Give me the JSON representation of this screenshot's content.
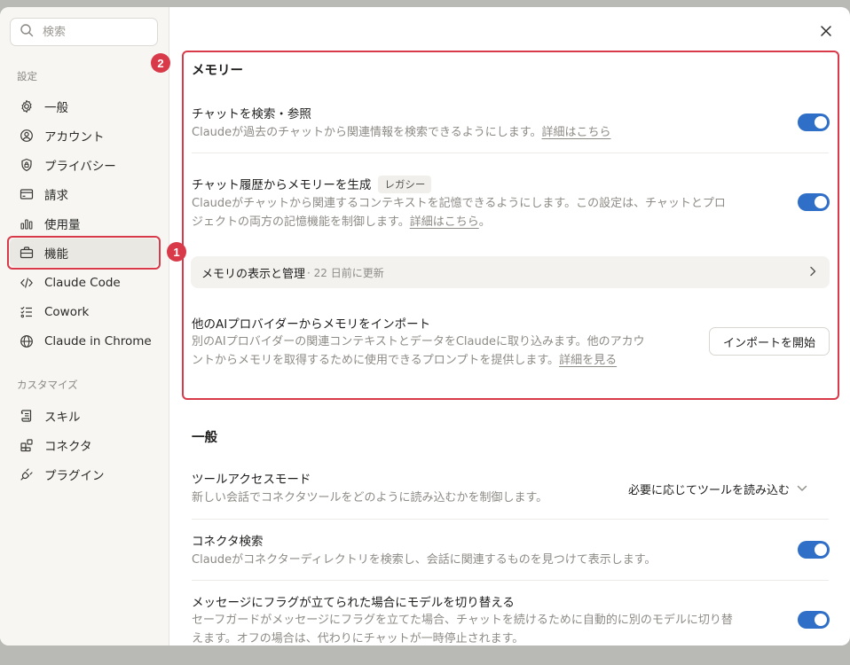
{
  "search": {
    "placeholder": "検索"
  },
  "sidebar": {
    "settings_label": "設定",
    "items": [
      {
        "label": "一般",
        "icon": "gear-icon"
      },
      {
        "label": "アカウント",
        "icon": "user-icon"
      },
      {
        "label": "プライバシー",
        "icon": "shield-lock-icon"
      },
      {
        "label": "請求",
        "icon": "card-icon"
      },
      {
        "label": "使用量",
        "icon": "bar-chart-icon"
      },
      {
        "label": "機能",
        "icon": "briefcase-icon",
        "active": true
      },
      {
        "label": "Claude Code",
        "icon": "code-icon"
      },
      {
        "label": "Cowork",
        "icon": "checklist-icon"
      },
      {
        "label": "Claude in Chrome",
        "icon": "globe-icon"
      }
    ],
    "customize_label": "カスタマイズ",
    "custom_items": [
      {
        "label": "スキル",
        "icon": "scroll-icon"
      },
      {
        "label": "コネクタ",
        "icon": "connector-icon"
      },
      {
        "label": "プラグイン",
        "icon": "plug-icon"
      }
    ]
  },
  "annotations": {
    "badge1": "1",
    "badge2": "2",
    "highlight_color": "#d93a4a"
  },
  "memory": {
    "title": "メモリー",
    "search_chats": {
      "title": "チャットを検索・参照",
      "desc": "Claudeが過去のチャットから関連情報を検索できるようにします。",
      "link": "詳細はこちら",
      "enabled": true
    },
    "generate": {
      "title": "チャット履歴からメモリーを生成",
      "tag": "レガシー",
      "desc_line1": "Claudeがチャットから関連するコンテキストを記憶できるようにします。この設定は、チャットとプロ",
      "desc_line2": "ジェクトの両方の記憶機能を制御します。",
      "link": "詳細はこちら",
      "suffix": "。",
      "enabled": true
    },
    "manage": {
      "label": "メモリの表示と管理",
      "sub": "· 22 日前に更新"
    },
    "import": {
      "title": "他のAIプロバイダーからメモリをインポート",
      "desc_line1": "別のAIプロバイダーの関連コンテキストとデータをClaudeに取り込みます。他のアカウ",
      "desc_line2": "ントからメモリを取得するために使用できるプロンプトを提供します。",
      "link": "詳細を見る",
      "button": "インポートを開始"
    }
  },
  "general": {
    "title": "一般",
    "tool_access": {
      "title": "ツールアクセスモード",
      "desc": "新しい会話でコネクタツールをどのように読み込むかを制御します。",
      "value": "必要に応じてツールを読み込む"
    },
    "connector_search": {
      "title": "コネクタ検索",
      "desc": "Claudeがコネクターディレクトリを検索し、会話に関連するものを見つけて表示します。",
      "enabled": true
    },
    "switch_model": {
      "title": "メッセージにフラグが立てられた場合にモデルを切り替える",
      "desc_line1": "セーフガードがメッセージにフラグを立てた場合、チャットを続けるために自動的に別のモデルに切り替",
      "desc_line2": "えます。オフの場合は、代わりにチャットが一時停止されます。",
      "enabled": true
    }
  },
  "colors": {
    "toggle_on": "#2f6fc7",
    "accent_red": "#d93a4a"
  }
}
